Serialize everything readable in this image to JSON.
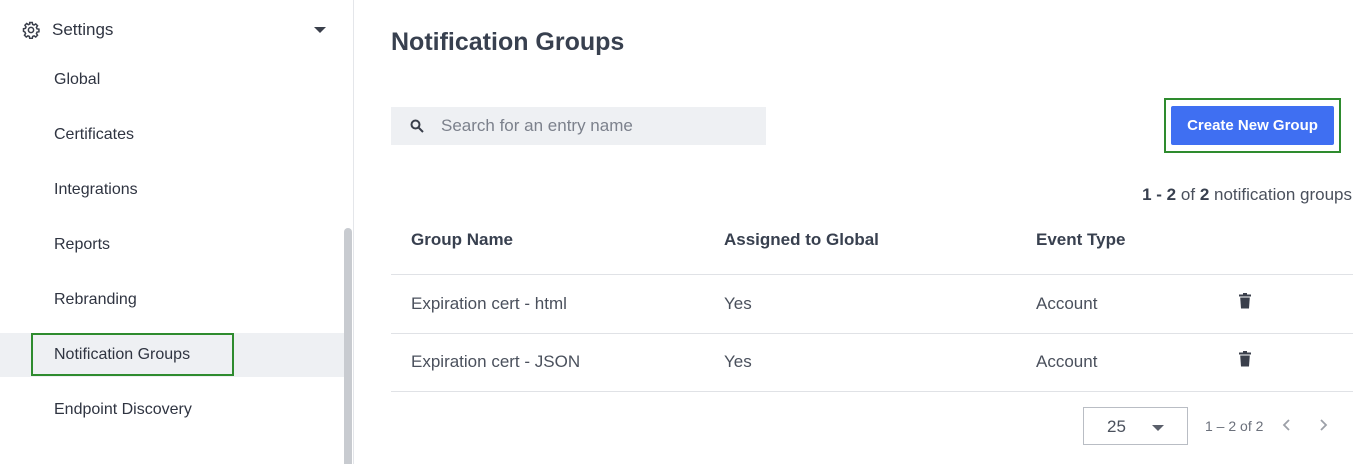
{
  "sidebar": {
    "section_label": "Settings",
    "section_icon": "gear-icon",
    "items": [
      {
        "label": "Global"
      },
      {
        "label": "Certificates"
      },
      {
        "label": "Integrations"
      },
      {
        "label": "Reports"
      },
      {
        "label": "Rebranding"
      },
      {
        "label": "Notification Groups",
        "active": true
      },
      {
        "label": "Endpoint Discovery"
      }
    ]
  },
  "main": {
    "title": "Notification Groups",
    "search": {
      "placeholder": "Search for an entry name",
      "value": ""
    },
    "create_button": "Create New Group",
    "count": {
      "range": "1 - 2",
      "of": "of",
      "total": "2",
      "suffix": "notification groups"
    },
    "table": {
      "headers": [
        "Group Name",
        "Assigned to Global",
        "Event Type"
      ],
      "rows": [
        {
          "name": "Expiration cert - html",
          "assigned": "Yes",
          "event": "Account"
        },
        {
          "name": "Expiration cert - JSON",
          "assigned": "Yes",
          "event": "Account"
        }
      ]
    },
    "pagination": {
      "page_size": "25",
      "range": "1 – 2 of 2"
    }
  },
  "colors": {
    "accent": "#3f6ff2",
    "highlight_border": "#2e8b2e",
    "active_bg": "#eef0f3"
  }
}
